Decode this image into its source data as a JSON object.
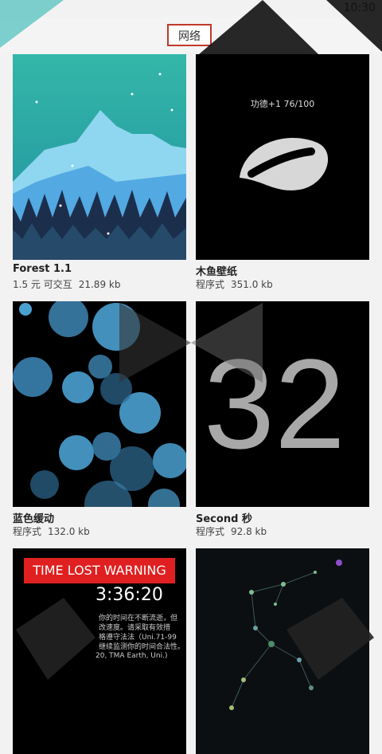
{
  "status_bar": {
    "time": "10:30"
  },
  "tabs": {
    "active_label": "网络"
  },
  "cards": [
    {
      "title": "Forest 1.1",
      "type": "1.5 元 可交互",
      "size": "21.89 kb"
    },
    {
      "title": "木鱼壁纸",
      "type": "程序式",
      "size": "351.0 kb",
      "preview_text": "功德+1 76/100"
    },
    {
      "title": "蓝色缓动",
      "type": "程序式",
      "size": "132.0 kb"
    },
    {
      "title": "Second 秒",
      "type": "程序式",
      "size": "92.8 kb",
      "preview_text": "32"
    },
    {
      "title": "",
      "type": "",
      "size": "",
      "preview_banner": "TIME LOST WARNING",
      "preview_clock": "3:36:20",
      "preview_lines": [
        "你的时间在不断流逝，但",
        "改速度。请采取有效措",
        "格遵守法法（Uni.71-99",
        "继续监测你的时间合法性。"
      ],
      "preview_credit": "20, TMA Earth, Uni.)"
    },
    {
      "title": "",
      "type": "",
      "size": ""
    }
  ]
}
